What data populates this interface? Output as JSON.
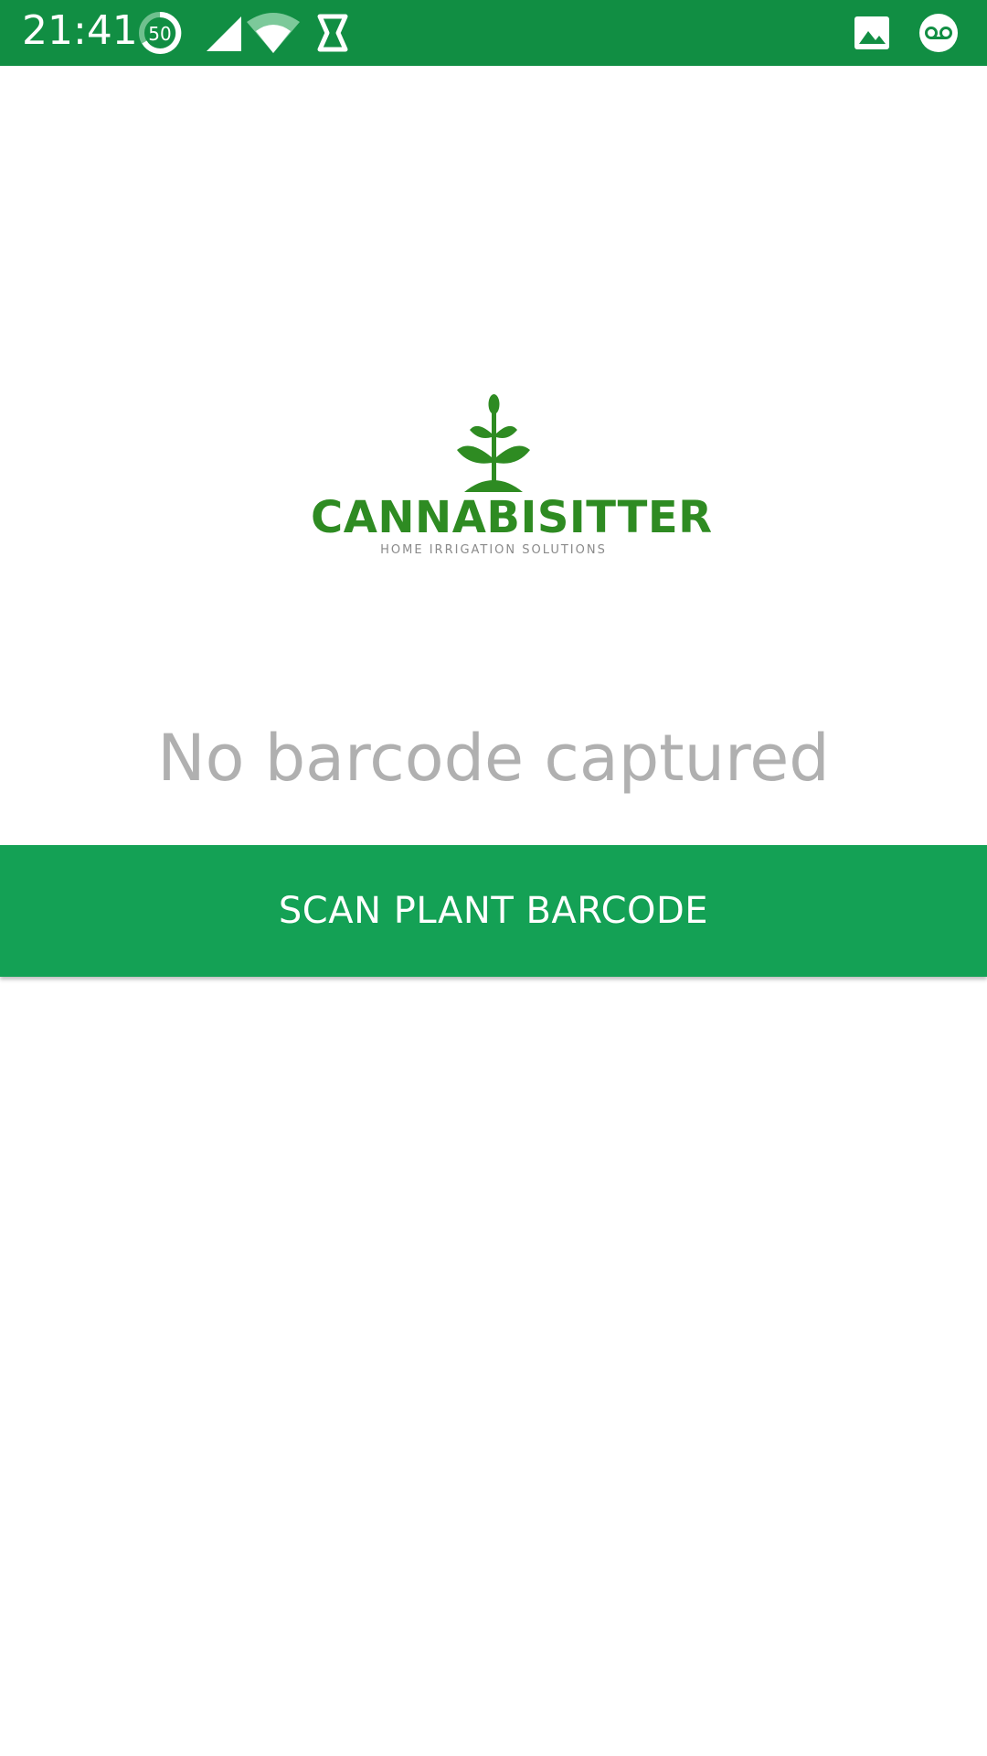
{
  "status_bar": {
    "time": "21:41",
    "data_saver_badge": "50",
    "icons": [
      "data-saver-icon",
      "cell-signal-icon",
      "wifi-icon",
      "nfc-icon",
      "image-notification-icon",
      "voicemail-icon"
    ],
    "background_color": "#118e43"
  },
  "logo": {
    "wordmark": "CANNABISITTER",
    "tagline": "HOME IRRIGATION SOLUTIONS",
    "icon": "plant-sprout-icon",
    "color": "#2e8b22"
  },
  "main": {
    "barcode_status": "No barcode captured",
    "scan_button_label": "SCAN PLANT BARCODE",
    "accent_color": "#14a155"
  }
}
